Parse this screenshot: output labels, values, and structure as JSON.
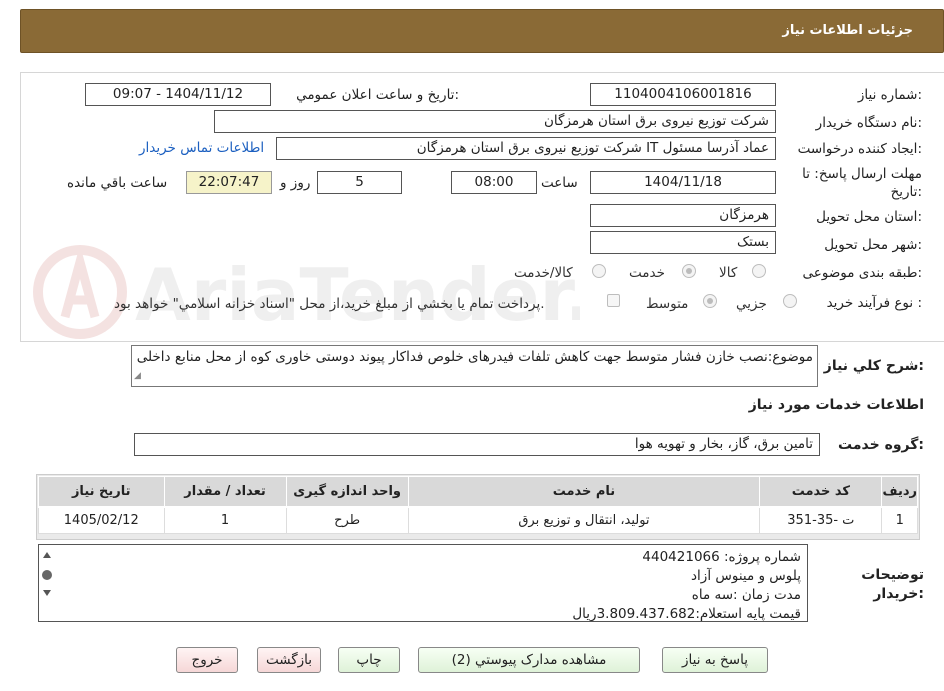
{
  "header": {
    "title": "جزئيات اطلاعات نياز"
  },
  "form": {
    "need_number_label": "شماره نياز:",
    "need_number": "1104004106001816",
    "announce_label": "تاريخ و ساعت اعلان عمومي:",
    "announce_value": "1404/11/12 - 09:07",
    "buyer_org_label": "نام دستگاه خريدار:",
    "buyer_org": "شركت توزيع نيروی برق استان هرمزگان",
    "requester_label": "ايجاد كننده درخواست:",
    "requester": "عماد آذرسا مسئول IT شركت توزيع نيروی برق استان هرمزگان",
    "contact_link": "اطلاعات تماس خريدار",
    "deadline_label_1": "مهلت ارسال پاسخ: تا",
    "deadline_label_2": "تاريخ:",
    "deadline_date": "1404/11/18",
    "time_label": "ساعت",
    "deadline_time": "08:00",
    "days_value": "5",
    "days_label": "روز و",
    "remaining_time": "22:07:47",
    "remaining_label": "ساعت باقي مانده",
    "province_label": "استان محل تحويل:",
    "province": "هرمزگان",
    "city_label": "شهر محل تحويل:",
    "city": "بستک",
    "category_label": "طبقه بندی موضوعی:",
    "category_options": [
      "كالا",
      "خدمت",
      "كالا/خدمت"
    ],
    "category_selected": "خدمت",
    "process_label": "نوع فرآيند خريد :",
    "process_options": [
      "جزيي",
      "متوسط"
    ],
    "process_selected": "متوسط",
    "payment_note": "پرداخت تمام يا بخشي از مبلغ خريد،از محل \"اسناد خزانه اسلامي\" خواهد بود."
  },
  "summary": {
    "label": "شرح كلي نياز:",
    "text": "موضوع:نصب خازن فشار متوسط جهت کاهش تلفات فیدرهای خلوص فداکار پیوند دوستی خاوری کوه از محل منابع داخلی"
  },
  "services": {
    "section_title": "اطلاعات خدمات مورد نياز",
    "group_label": "گروه خدمت:",
    "group_value": "تامين برق، گاز، بخار و تهويه هوا",
    "columns": [
      "رديف",
      "كد خدمت",
      "نام خدمت",
      "واحد اندازه گيری",
      "تعداد / مقدار",
      "تاريخ نياز"
    ],
    "rows": [
      [
        "1",
        "ت -35-351",
        "توليد، انتقال و توزيع برق",
        "طرح",
        "1",
        "1405/02/12"
      ]
    ]
  },
  "notes": {
    "label_1": "توضيحات",
    "label_2": "خريدار:",
    "lines": [
      "شماره پروژه:  440421066",
      " پلوس و مینوس آزاد",
      "مدت زمان :سه ماه",
      "قیمت پایه استعلام:3.809.437.682ریال"
    ]
  },
  "buttons": {
    "reply": "پاسخ به نياز",
    "attachments": "مشاهده مدارک پيوستي (2)",
    "print": "چاپ",
    "back": "بازگشت",
    "exit": "خروج"
  },
  "watermark": {
    "brand": "AriaTender.neT"
  }
}
